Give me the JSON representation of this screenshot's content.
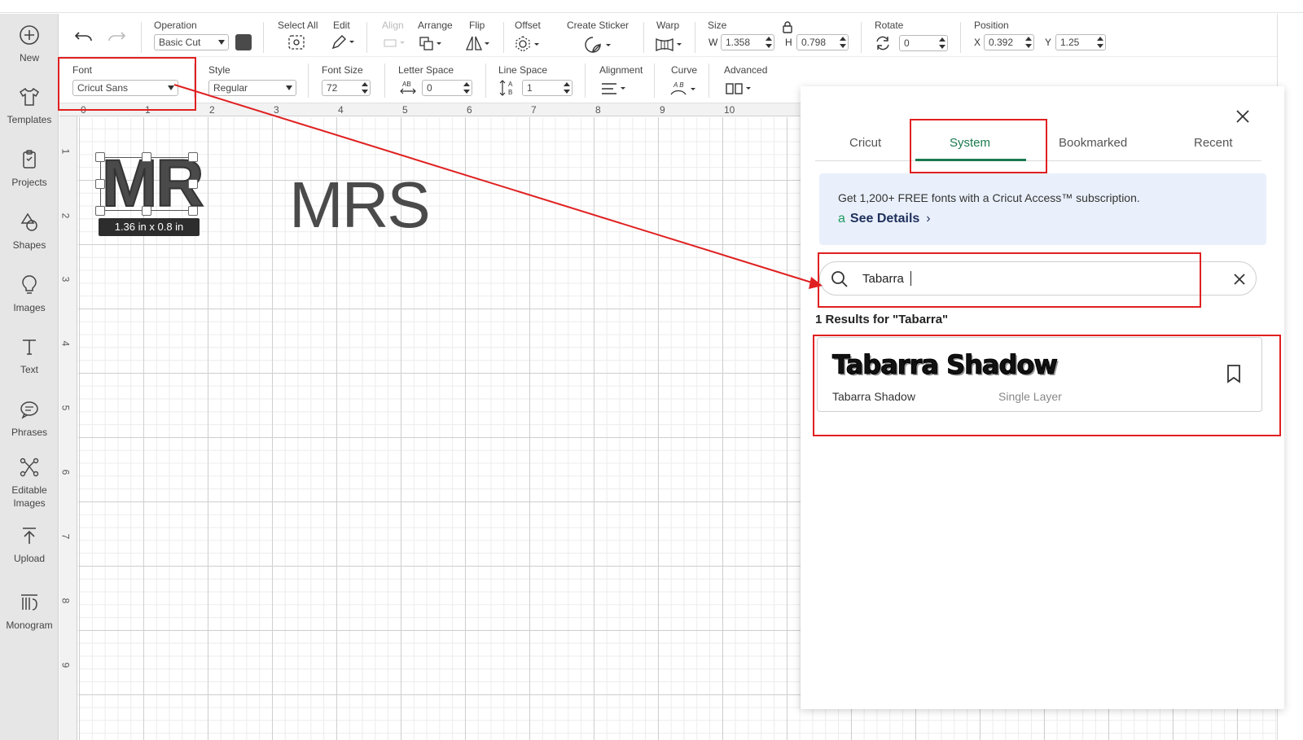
{
  "sidebar": {
    "items": [
      {
        "label": "New",
        "icon": "plus-circle-icon"
      },
      {
        "label": "Templates",
        "icon": "shirt-icon"
      },
      {
        "label": "Projects",
        "icon": "clipboard-icon"
      },
      {
        "label": "Shapes",
        "icon": "shapes-icon"
      },
      {
        "label": "Images",
        "icon": "bulb-icon"
      },
      {
        "label": "Text",
        "icon": "text-icon"
      },
      {
        "label": "Phrases",
        "icon": "speech-bubble-icon"
      },
      {
        "label": "Editable",
        "label2": "Images",
        "icon": "editable-images-icon"
      },
      {
        "label": "Upload",
        "icon": "upload-icon"
      },
      {
        "label": "Monogram",
        "icon": "monogram-icon"
      }
    ]
  },
  "toolbar": {
    "operation_label": "Operation",
    "operation_value": "Basic Cut",
    "select_all_label": "Select All",
    "edit_label": "Edit",
    "align_label": "Align",
    "arrange_label": "Arrange",
    "flip_label": "Flip",
    "offset_label": "Offset",
    "create_sticker_label": "Create Sticker",
    "warp_label": "Warp",
    "size_label": "Size",
    "size_w_label": "W",
    "size_w_value": "1.358",
    "size_h_label": "H",
    "size_h_value": "0.798",
    "rotate_label": "Rotate",
    "rotate_value": "0",
    "position_label": "Position",
    "position_x_label": "X",
    "position_x_value": "0.392",
    "position_y_label": "Y",
    "position_y_value": "1.25"
  },
  "text_toolbar": {
    "font_label": "Font",
    "font_value": "Cricut Sans",
    "style_label": "Style",
    "style_value": "Regular",
    "font_size_label": "Font Size",
    "font_size_value": "72",
    "letter_space_label": "Letter Space",
    "letter_space_value": "0",
    "line_space_label": "Line Space",
    "line_space_value": "1",
    "alignment_label": "Alignment",
    "curve_label": "Curve",
    "advanced_label": "Advanced"
  },
  "canvas": {
    "ruler_top": [
      "0",
      "1",
      "2",
      "3",
      "4",
      "5",
      "6",
      "7",
      "8",
      "9",
      "10"
    ],
    "ruler_left": [
      "1",
      "2",
      "3",
      "4",
      "5",
      "6",
      "7",
      "8",
      "9"
    ],
    "selected_text": "MR",
    "selection_dimensions": "1.36  in x 0.8  in",
    "other_text": "MRS"
  },
  "font_panel": {
    "tabs": [
      "Cricut",
      "System",
      "Bookmarked",
      "Recent"
    ],
    "active_tab": "System",
    "promo_text": "Get 1,200+ FREE fonts with a Cricut Access™ subscription.",
    "promo_link": "See Details",
    "search_value": "Tabarra",
    "results_title": "1 Results for \"Tabarra\"",
    "results": [
      {
        "preview": "Tabarra Shadow",
        "name": "Tabarra Shadow",
        "layer": "Single Layer"
      }
    ]
  },
  "colors": {
    "accent": "#1a7a4e",
    "annotation": "#e02020",
    "promo_bg": "#e9f0fb",
    "swatch": "#4a4a4a"
  }
}
